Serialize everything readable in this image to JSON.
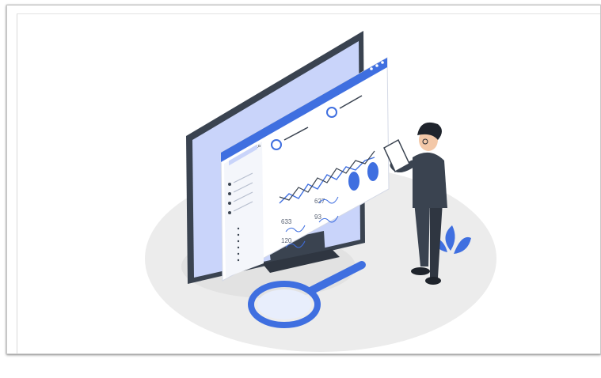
{
  "illustration": {
    "accent": "#3f6fe0",
    "accent_light": "#c9d4fa",
    "dark": "#3a4350",
    "platform": "#ececec",
    "icon": "data-analysis-illustration"
  },
  "dashboard": {
    "stats": [
      "627",
      "633",
      "93",
      "120"
    ]
  }
}
